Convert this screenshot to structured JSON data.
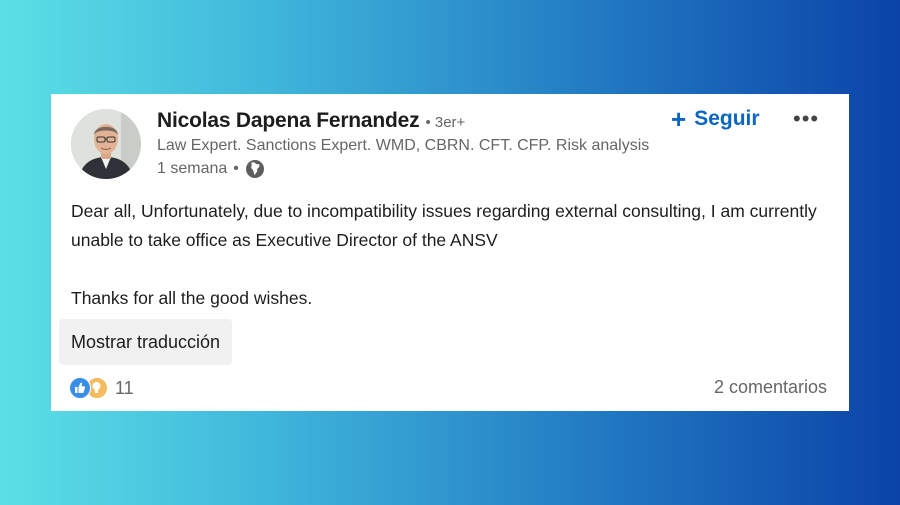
{
  "post": {
    "author": {
      "name": "Nicolas Dapena Fernandez",
      "degree": "• 3er+",
      "headline": "Law Expert. Sanctions Expert. WMD, CBRN. CFT. CFP. Risk analysis",
      "time": "1 semana",
      "separator": "•",
      "visibility_icon": "globe-icon"
    },
    "follow_label": "Seguir",
    "follow_icon": "plus-icon",
    "more_icon": "ellipsis-icon",
    "body": {
      "paragraph1": "Dear all, Unfortunately, due to incompatibility issues regarding external consulting, I am currently unable to take office as Executive Director of the ANSV",
      "paragraph2": "Thanks for all the good wishes."
    },
    "translate_label": "Mostrar traducción",
    "reactions": {
      "icons": [
        "like-icon",
        "insight-icon"
      ],
      "count": "11"
    },
    "comments_label": "2 comentarios"
  },
  "colors": {
    "accent": "#0a66c2",
    "like": "#378fe9",
    "insight": "#f5bb5c",
    "gradient_start": "#5ce0e6",
    "gradient_end": "#0b43a8"
  }
}
